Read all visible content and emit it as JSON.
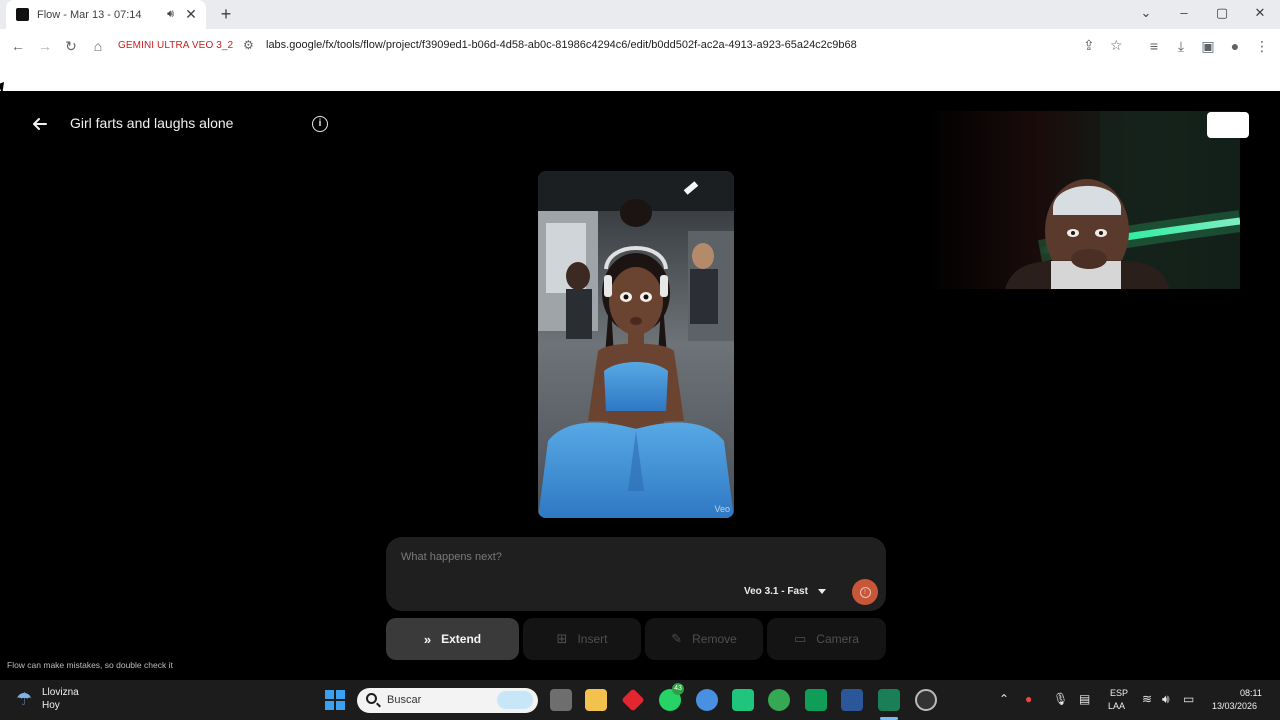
{
  "browser": {
    "tab_title": "Flow - Mar 13 - 07:14",
    "audio_icon": "speaker-icon",
    "close_glyph": "✕",
    "new_tab_glyph": "+",
    "bookmark_label": "GEMINI ULTRA VEO 3_2",
    "url": "labs.google/fx/tools/flow/project/f3909ed1-b06d-4d58-ab0c-81986c4294c6/edit/b0dd502f-ac2a-4913-a923-65a24c2c9b68"
  },
  "page": {
    "title": "Girl farts and laughs alone",
    "video_watermark": "Veo",
    "prompt_placeholder": "What happens next?",
    "model_label": "Veo 3.1 - Fast",
    "actions": {
      "extend": "Extend",
      "insert": "Insert",
      "remove": "Remove",
      "camera": "Camera"
    },
    "disclaimer": "Flow can make mistakes, so double check it"
  },
  "taskbar": {
    "weather_title": "Llovizna",
    "weather_subtitle": "Hoy",
    "search_label": "Buscar",
    "whatsapp_badge": "43",
    "lang_line1": "ESP",
    "lang_line2": "LAA",
    "time": "08:11",
    "date": "13/03/2026"
  },
  "colors": {
    "accent_submit": "#c8573a",
    "bookmark_text": "#c5221f",
    "page_bg": "#000000"
  }
}
